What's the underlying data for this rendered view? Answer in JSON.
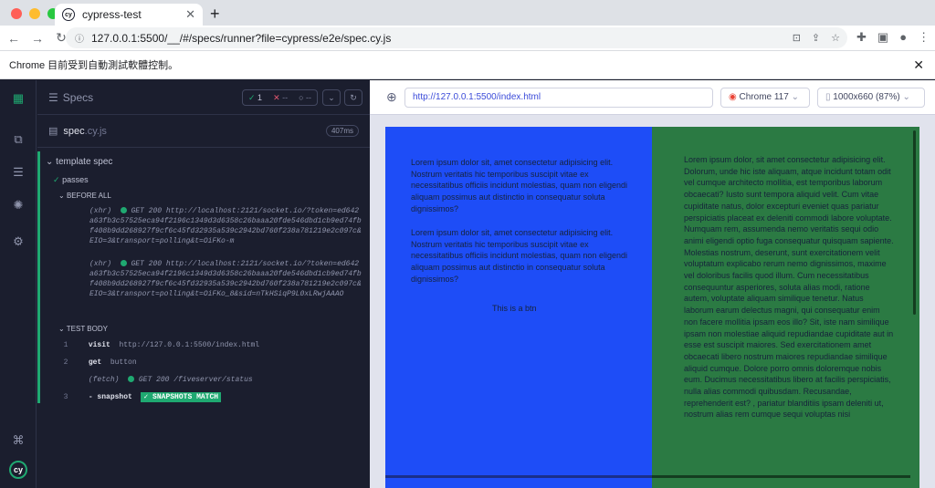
{
  "browser": {
    "tab_title": "cypress-test",
    "url": "127.0.0.1:5500/__/#/specs/runner?file=cypress/e2e/spec.cy.js",
    "infobar": "Chrome 目前受到自動測試軟體控制。"
  },
  "reporter": {
    "header": "Specs",
    "passed_count": "1",
    "failed_count": "--",
    "pending_count": "--",
    "file_name": "spec",
    "file_ext": ".cy.js",
    "duration": "407ms",
    "suite": "template spec",
    "test": "passes",
    "before_all": "BEFORE ALL",
    "test_body": "TEST BODY",
    "xhr1": {
      "type": "(xhr)",
      "text": "GET 200 http://localhost:2121/socket.io/?token=ed642a63fb3c57525eca94f2196c1349d3d6358c26baaa20fde546dbd1cb9ed74fbf408b9dd268927f9cf6c45fd32935a539c2942bd760f238a781219e2c097c&EIO=3&transport=polling&t=OiFKo-m"
    },
    "xhr2": {
      "type": "(xhr)",
      "text": "GET 200 http://localhost:2121/socket.io/?token=ed642a63fb3c57525eca94f2196c1349d3d6358c26baaa20fde546dbd1cb9ed74fbf408b9dd268927f9cf6c45fd32935a539c2942bd760f238a781219e2c097c&EIO=3&transport=polling&t=OiFKo_8&sid=nTkHSiqP9L0xLRwjAAAO"
    },
    "steps": [
      {
        "num": "1",
        "cmd": "visit",
        "arg": "http://127.0.0.1:5500/index.html"
      },
      {
        "num": "2",
        "cmd": "get",
        "arg": "button"
      },
      {
        "num": "",
        "cmd": "(fetch)",
        "arg": "GET 200 /fiveserver/status"
      },
      {
        "num": "3",
        "cmd": "- snapshot",
        "arg": "✓ SNAPSHOTS MATCH"
      }
    ]
  },
  "aut": {
    "url": "http://127.0.0.1:5500/index.html",
    "browser": "Chrome 117",
    "viewport": "1000x660 (87%)",
    "para1": "Lorem ipsum dolor sit, amet consectetur adipisicing elit. Nostrum veritatis hic temporibus suscipit vitae ex necessitatibus officiis incidunt molestias, quam non eligendi aliquam possimus aut distinctio in consequatur soluta dignissimos?",
    "para2": "Lorem ipsum dolor sit, amet consectetur adipisicing elit. Nostrum veritatis hic temporibus suscipit vitae ex necessitatibus officiis incidunt molestias, quam non eligendi aliquam possimus aut distinctio in consequatur soluta dignissimos?",
    "button": "This is a btn",
    "para3": "Lorem ipsum dolor, sit amet consectetur adipisicing elit. Dolorum, unde hic iste aliquam, atque incidunt totam odit vel cumque architecto mollitia, est temporibus laborum obcaecati? Iusto sunt tempora aliquid velit. Cum vitae cupiditate natus, dolor excepturi eveniet quas pariatur perspiciatis placeat ex deleniti commodi labore voluptate. Numquam rem, assumenda nemo veritatis sequi odio animi eligendi optio fuga consequatur quisquam sapiente. Molestias nostrum, deserunt, sunt exercitationem velit voluptatum explicabo rerum nemo dignissimos, maxime vel doloribus facilis quod illum. Cum necessitatibus consequuntur asperiores, soluta alias modi, ratione autem, voluptate aliquam similique tenetur. Natus laborum earum delectus magni, qui consequatur enim non facere mollitia ipsam eos illo? Sit, iste nam similique ipsam non molestiae aliquid repudiandae cupiditate aut in esse est suscipit maiores. Sed exercitationem amet obcaecati libero nostrum maiores repudiandae similique aliquid cumque. Dolore porro omnis doloremque nobis eum. Ducimus necessitatibus libero at facilis perspiciatis, nulla alias commodi quibusdam. Recusandae, reprehenderit est? , pariatur blanditiis ipsam deleniti ut, nostrum alias rem cumque sequi voluptas nisi"
  },
  "colors": {
    "pass_green": "#1fa971",
    "blue_col": "#1e4df7",
    "green_col": "#2b7a43"
  }
}
